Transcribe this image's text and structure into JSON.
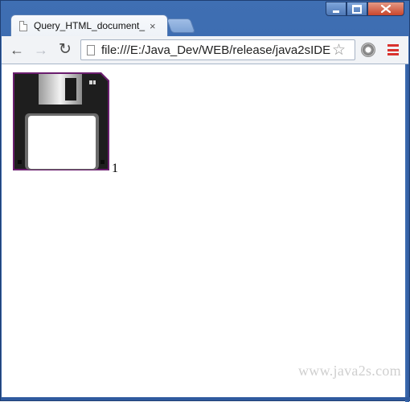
{
  "window": {
    "tab_title": "Query_HTML_document_",
    "tab_close": "×"
  },
  "toolbar": {
    "back_icon": "←",
    "forward_icon": "→",
    "reload_icon": "↻",
    "url": "file:///E:/Java_Dev/WEB/release/java2sIDE",
    "star_icon": "☆",
    "extension_icon": "extension-icon",
    "menu_icon": "hamburger-menu-icon"
  },
  "page": {
    "image_label": "floppy-disk-image",
    "number_text": "1",
    "watermark": "www.java2s.com"
  },
  "colors": {
    "frame": "#2f5a9e",
    "menu_accent": "#d9322e",
    "close_button": "#c9452b"
  }
}
